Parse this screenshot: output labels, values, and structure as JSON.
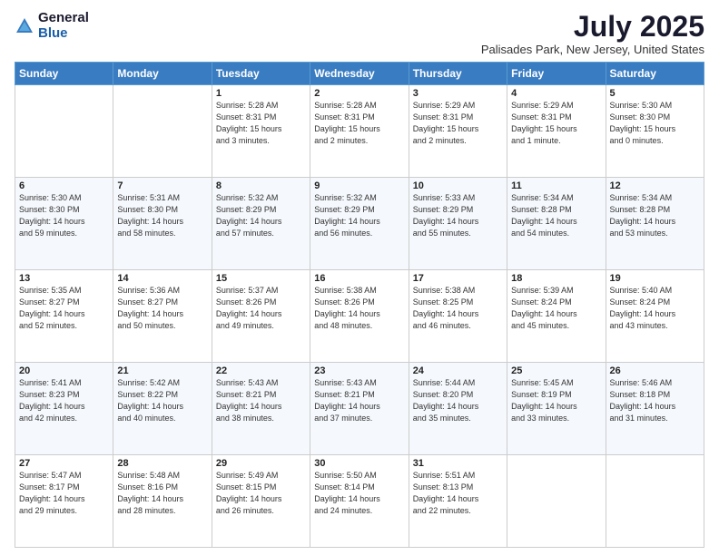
{
  "logo": {
    "general": "General",
    "blue": "Blue"
  },
  "title": "July 2025",
  "subtitle": "Palisades Park, New Jersey, United States",
  "days_of_week": [
    "Sunday",
    "Monday",
    "Tuesday",
    "Wednesday",
    "Thursday",
    "Friday",
    "Saturday"
  ],
  "weeks": [
    [
      {
        "day": "",
        "info": ""
      },
      {
        "day": "",
        "info": ""
      },
      {
        "day": "1",
        "info": "Sunrise: 5:28 AM\nSunset: 8:31 PM\nDaylight: 15 hours\nand 3 minutes."
      },
      {
        "day": "2",
        "info": "Sunrise: 5:28 AM\nSunset: 8:31 PM\nDaylight: 15 hours\nand 2 minutes."
      },
      {
        "day": "3",
        "info": "Sunrise: 5:29 AM\nSunset: 8:31 PM\nDaylight: 15 hours\nand 2 minutes."
      },
      {
        "day": "4",
        "info": "Sunrise: 5:29 AM\nSunset: 8:31 PM\nDaylight: 15 hours\nand 1 minute."
      },
      {
        "day": "5",
        "info": "Sunrise: 5:30 AM\nSunset: 8:30 PM\nDaylight: 15 hours\nand 0 minutes."
      }
    ],
    [
      {
        "day": "6",
        "info": "Sunrise: 5:30 AM\nSunset: 8:30 PM\nDaylight: 14 hours\nand 59 minutes."
      },
      {
        "day": "7",
        "info": "Sunrise: 5:31 AM\nSunset: 8:30 PM\nDaylight: 14 hours\nand 58 minutes."
      },
      {
        "day": "8",
        "info": "Sunrise: 5:32 AM\nSunset: 8:29 PM\nDaylight: 14 hours\nand 57 minutes."
      },
      {
        "day": "9",
        "info": "Sunrise: 5:32 AM\nSunset: 8:29 PM\nDaylight: 14 hours\nand 56 minutes."
      },
      {
        "day": "10",
        "info": "Sunrise: 5:33 AM\nSunset: 8:29 PM\nDaylight: 14 hours\nand 55 minutes."
      },
      {
        "day": "11",
        "info": "Sunrise: 5:34 AM\nSunset: 8:28 PM\nDaylight: 14 hours\nand 54 minutes."
      },
      {
        "day": "12",
        "info": "Sunrise: 5:34 AM\nSunset: 8:28 PM\nDaylight: 14 hours\nand 53 minutes."
      }
    ],
    [
      {
        "day": "13",
        "info": "Sunrise: 5:35 AM\nSunset: 8:27 PM\nDaylight: 14 hours\nand 52 minutes."
      },
      {
        "day": "14",
        "info": "Sunrise: 5:36 AM\nSunset: 8:27 PM\nDaylight: 14 hours\nand 50 minutes."
      },
      {
        "day": "15",
        "info": "Sunrise: 5:37 AM\nSunset: 8:26 PM\nDaylight: 14 hours\nand 49 minutes."
      },
      {
        "day": "16",
        "info": "Sunrise: 5:38 AM\nSunset: 8:26 PM\nDaylight: 14 hours\nand 48 minutes."
      },
      {
        "day": "17",
        "info": "Sunrise: 5:38 AM\nSunset: 8:25 PM\nDaylight: 14 hours\nand 46 minutes."
      },
      {
        "day": "18",
        "info": "Sunrise: 5:39 AM\nSunset: 8:24 PM\nDaylight: 14 hours\nand 45 minutes."
      },
      {
        "day": "19",
        "info": "Sunrise: 5:40 AM\nSunset: 8:24 PM\nDaylight: 14 hours\nand 43 minutes."
      }
    ],
    [
      {
        "day": "20",
        "info": "Sunrise: 5:41 AM\nSunset: 8:23 PM\nDaylight: 14 hours\nand 42 minutes."
      },
      {
        "day": "21",
        "info": "Sunrise: 5:42 AM\nSunset: 8:22 PM\nDaylight: 14 hours\nand 40 minutes."
      },
      {
        "day": "22",
        "info": "Sunrise: 5:43 AM\nSunset: 8:21 PM\nDaylight: 14 hours\nand 38 minutes."
      },
      {
        "day": "23",
        "info": "Sunrise: 5:43 AM\nSunset: 8:21 PM\nDaylight: 14 hours\nand 37 minutes."
      },
      {
        "day": "24",
        "info": "Sunrise: 5:44 AM\nSunset: 8:20 PM\nDaylight: 14 hours\nand 35 minutes."
      },
      {
        "day": "25",
        "info": "Sunrise: 5:45 AM\nSunset: 8:19 PM\nDaylight: 14 hours\nand 33 minutes."
      },
      {
        "day": "26",
        "info": "Sunrise: 5:46 AM\nSunset: 8:18 PM\nDaylight: 14 hours\nand 31 minutes."
      }
    ],
    [
      {
        "day": "27",
        "info": "Sunrise: 5:47 AM\nSunset: 8:17 PM\nDaylight: 14 hours\nand 29 minutes."
      },
      {
        "day": "28",
        "info": "Sunrise: 5:48 AM\nSunset: 8:16 PM\nDaylight: 14 hours\nand 28 minutes."
      },
      {
        "day": "29",
        "info": "Sunrise: 5:49 AM\nSunset: 8:15 PM\nDaylight: 14 hours\nand 26 minutes."
      },
      {
        "day": "30",
        "info": "Sunrise: 5:50 AM\nSunset: 8:14 PM\nDaylight: 14 hours\nand 24 minutes."
      },
      {
        "day": "31",
        "info": "Sunrise: 5:51 AM\nSunset: 8:13 PM\nDaylight: 14 hours\nand 22 minutes."
      },
      {
        "day": "",
        "info": ""
      },
      {
        "day": "",
        "info": ""
      }
    ]
  ]
}
